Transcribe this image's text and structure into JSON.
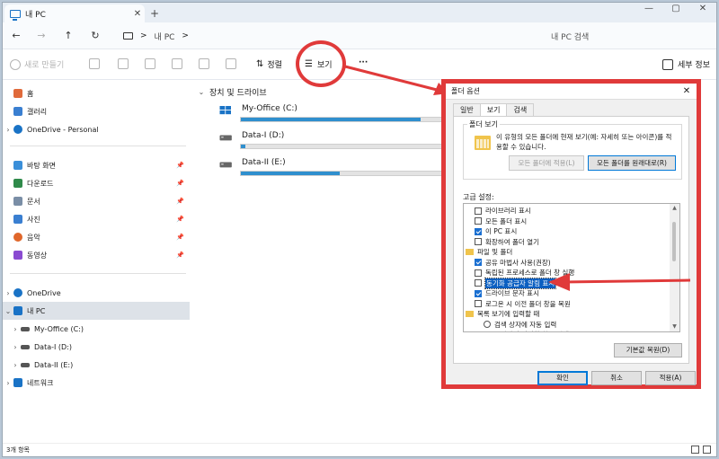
{
  "window": {
    "tab_title": "내 PC",
    "tab_close": "✕",
    "new_tab": "+",
    "controls": [
      "—",
      "▢",
      "✕"
    ]
  },
  "nav": {
    "back": "←",
    "forward": "→",
    "up": "↑",
    "refresh": "↻",
    "path": "내 PC",
    "path_chevron": ">",
    "search_placeholder": "내 PC 검색"
  },
  "toolbar": {
    "new_label": "새로 만들기",
    "sort_label": "정렬",
    "view_label": "보기",
    "more_label": "···",
    "details_label": "세부 정보"
  },
  "sidebar": {
    "quick": [
      {
        "label": "홈",
        "icon": "home-icon",
        "color": "#e06a3b"
      },
      {
        "label": "갤러리",
        "icon": "gallery-icon",
        "color": "#3a7fd1"
      },
      {
        "label": "OneDrive - Personal",
        "icon": "cloud-icon",
        "color": "#1a73c6"
      }
    ],
    "pinned": [
      {
        "label": "바탕 화면",
        "icon": "desktop-icon",
        "color": "#3a8fd9"
      },
      {
        "label": "다운로드",
        "icon": "download-icon",
        "color": "#2f8a4a"
      },
      {
        "label": "문서",
        "icon": "documents-icon",
        "color": "#7a8ea6"
      },
      {
        "label": "사진",
        "icon": "pictures-icon",
        "color": "#3a7fd1"
      },
      {
        "label": "음악",
        "icon": "music-icon",
        "color": "#e0672b"
      },
      {
        "label": "동영상",
        "icon": "videos-icon",
        "color": "#8a4bd1"
      }
    ],
    "tree": [
      {
        "label": "OneDrive",
        "icon": "cloud-icon",
        "color": "#1a73c6"
      },
      {
        "label": "내 PC",
        "icon": "pc-icon",
        "color": "#1a73c6"
      },
      {
        "label": "My-Office (C:)",
        "icon": "drive-icon",
        "color": "#555555"
      },
      {
        "label": "Data-I (D:)",
        "icon": "drive-icon",
        "color": "#555555"
      },
      {
        "label": "Data-II (E:)",
        "icon": "drive-icon",
        "color": "#555555"
      },
      {
        "label": "네트워크",
        "icon": "network-icon",
        "color": "#1a73c6"
      }
    ]
  },
  "main": {
    "section_title": "장치 및 드라이브",
    "drives": [
      {
        "name": "My-Office (C:)",
        "used_fraction": 0.82
      },
      {
        "name": "Data-I (D:)",
        "used_fraction": 0.02
      },
      {
        "name": "Data-II (E:)",
        "used_fraction": 0.45
      }
    ]
  },
  "status": {
    "item_count": "3개 항목"
  },
  "dialog": {
    "title": "폴더 옵션",
    "close": "✕",
    "tabs": [
      "일반",
      "보기",
      "검색"
    ],
    "active_tab": "보기",
    "group_title": "폴더 보기",
    "group_desc": "이 유형의 모든 폴더에 현재 보기(예: 자세히 또는 아이콘)를 적용할 수 있습니다.",
    "apply_all_label": "모든 폴더에 적용(L)",
    "reset_all_label": "모든 폴더를 원래대로(R)",
    "advanced_label": "고급 설정:",
    "settings": [
      {
        "label": "라이브러리 표시",
        "type": "checkbox",
        "checked": false
      },
      {
        "label": "모든 폴더 표시",
        "type": "checkbox",
        "checked": false
      },
      {
        "label": "이 PC 표시",
        "type": "checkbox",
        "checked": true
      },
      {
        "label": "확장하여 폴더 열기",
        "type": "checkbox",
        "checked": false
      },
      {
        "label": "파일 및 폴더",
        "type": "folder",
        "checked": false
      },
      {
        "label": "공유 마법사 사용(권장)",
        "type": "checkbox",
        "checked": true
      },
      {
        "label": "독립된 프로세스로 폴더 창 실행",
        "type": "checkbox",
        "checked": false
      },
      {
        "label": "동기화 공급자 알림 표시",
        "type": "checkbox",
        "checked": false,
        "highlight": true
      },
      {
        "label": "드라이브 문자 표시",
        "type": "checkbox",
        "checked": true
      },
      {
        "label": "로그온 시 이전 폴더 창을 복원",
        "type": "checkbox",
        "checked": false
      },
      {
        "label": "목록 보기에 입력할 때",
        "type": "folder",
        "checked": false
      },
      {
        "label": "검색 상자에 자동 입력",
        "type": "radio",
        "checked": false
      },
      {
        "label": "보기에서 입력한 항목 선택",
        "type": "radio",
        "checked": true
      }
    ],
    "restore_defaults_label": "기본값 복원(D)",
    "ok_label": "확인",
    "cancel_label": "취소",
    "apply_label": "적용(A)"
  },
  "colors": {
    "annotation_red": "#e03a3a",
    "drive_bar": "#2f8fce",
    "highlight": "#0b5fc1"
  }
}
